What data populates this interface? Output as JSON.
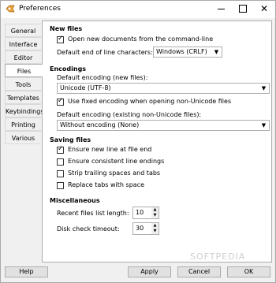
{
  "window": {
    "title": "Preferences"
  },
  "tabs": [
    {
      "label": "General"
    },
    {
      "label": "Interface"
    },
    {
      "label": "Editor"
    },
    {
      "label": "Files"
    },
    {
      "label": "Tools"
    },
    {
      "label": "Templates"
    },
    {
      "label": "Keybindings"
    },
    {
      "label": "Printing"
    },
    {
      "label": "Various"
    }
  ],
  "active_tab": "Files",
  "new_files": {
    "title": "New files",
    "open_new_docs": {
      "label": "Open new documents from the command-line",
      "checked": true
    },
    "eol_label": "Default end of line characters:",
    "eol_value": "Windows (CRLF)"
  },
  "encodings": {
    "title": "Encodings",
    "default_label": "Default encoding (new files):",
    "default_value": "Unicode (UTF-8)",
    "fixed_encoding": {
      "label": "Use fixed encoding when opening non-Unicode files",
      "checked": true
    },
    "existing_label": "Default encoding (existing non-Unicode files):",
    "existing_value": "Without encoding (None)"
  },
  "saving": {
    "title": "Saving files",
    "items": [
      {
        "label": "Ensure new line at file end",
        "checked": true
      },
      {
        "label": "Ensure consistent line endings",
        "checked": false
      },
      {
        "label": "Strip trailing spaces and tabs",
        "checked": false
      },
      {
        "label": "Replace tabs with space",
        "checked": false
      }
    ]
  },
  "misc": {
    "title": "Miscellaneous",
    "recent_label": "Recent files list length:",
    "recent_value": "10",
    "disk_label": "Disk check timeout:",
    "disk_value": "30"
  },
  "buttons": {
    "help": "Help",
    "apply": "Apply",
    "cancel": "Cancel",
    "ok": "OK"
  },
  "watermark": "SOFTPEDIA"
}
